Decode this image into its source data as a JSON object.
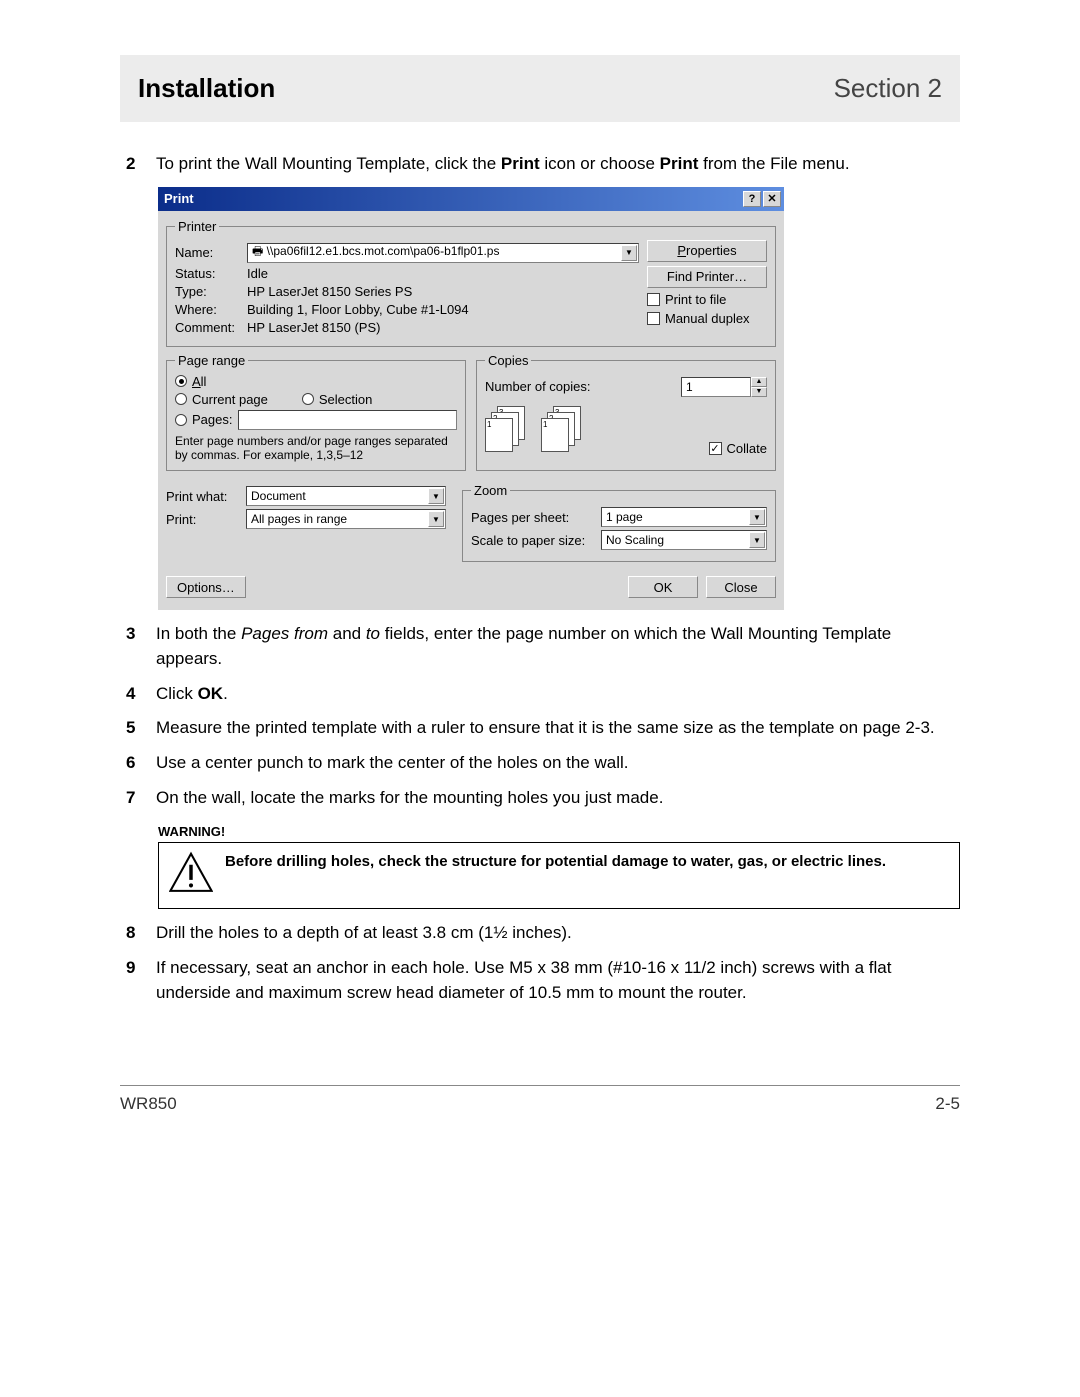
{
  "header": {
    "title": "Installation",
    "section": "Section 2"
  },
  "steps": {
    "s2_pre": "To print the Wall Mounting Template, click the ",
    "s2_b1": "Print",
    "s2_mid": " icon or choose ",
    "s2_b2": "Print",
    "s2_post": " from the File menu.",
    "s3_pre": "In both the ",
    "s3_i1": "Pages from",
    "s3_mid": " and ",
    "s3_i2": "to",
    "s3_post": " fields, enter the page number on which the Wall Mounting Template appears.",
    "s4_pre": "Click ",
    "s4_b": "OK",
    "s4_post": ".",
    "s5": "Measure the printed template with a ruler to ensure that it is the same size as the template on page 2-3.",
    "s6": "Use a center punch to mark the center of the holes on the wall.",
    "s7": "On the wall, locate the marks for the mounting holes you just made.",
    "s8": "Drill the holes to a depth of at least 3.8 cm (1½ inches).",
    "s9": "If necessary, seat an anchor in each hole. Use M5 x 38 mm (#10-16 x 11/2 inch) screws with a flat underside and maximum screw head diameter of 10.5 mm to mount the router."
  },
  "dialog": {
    "title": "Print",
    "help_glyph": "?",
    "close_glyph": "✕",
    "printer": {
      "legend": "Printer",
      "name_label": "Name:",
      "name_value": "\\\\pa06fil12.e1.bcs.mot.com\\pa06-b1flp01.ps",
      "status_label": "Status:",
      "status_value": "Idle",
      "type_label": "Type:",
      "type_value": "HP LaserJet 8150 Series PS",
      "where_label": "Where:",
      "where_value": "Building 1, Floor Lobby, Cube #1-L094",
      "comment_label": "Comment:",
      "comment_value": "HP LaserJet 8150 (PS)",
      "properties_btn": "Properties",
      "find_btn": "Find Printer…",
      "print_to_file": "Print to file",
      "manual_duplex": "Manual duplex"
    },
    "page_range": {
      "legend": "Page range",
      "all": "All",
      "current": "Current page",
      "selection": "Selection",
      "pages": "Pages:",
      "hint": "Enter page numbers and/or page ranges separated by commas.  For example, 1,3,5–12"
    },
    "copies": {
      "legend": "Copies",
      "num_label": "Number of copies:",
      "num_value": "1",
      "collate": "Collate"
    },
    "print_what_label": "Print what:",
    "print_what_value": "Document",
    "print_label": "Print:",
    "print_value": "All pages in range",
    "zoom": {
      "legend": "Zoom",
      "pps_label": "Pages per sheet:",
      "pps_value": "1 page",
      "scale_label": "Scale to paper size:",
      "scale_value": "No Scaling"
    },
    "options_btn": "Options…",
    "ok_btn": "OK",
    "close_btn": "Close"
  },
  "warning": {
    "title": "WARNING!",
    "text": "Before drilling holes, check the structure for potential damage to water, gas, or electric lines."
  },
  "footer": {
    "left": "WR850",
    "right": "2-5"
  }
}
